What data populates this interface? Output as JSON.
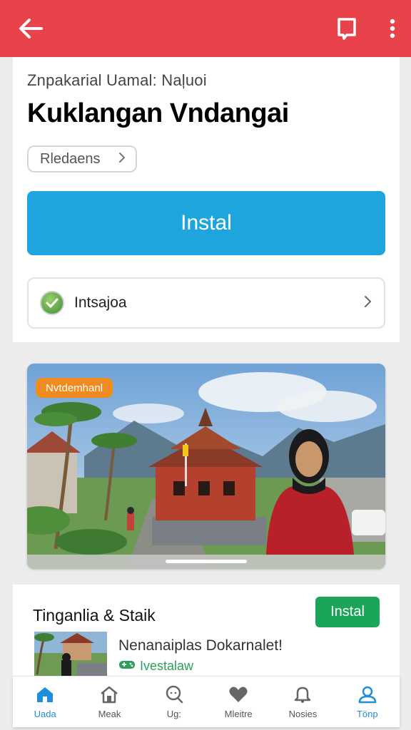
{
  "colors": {
    "appbar": "#e8424a",
    "install_primary": "#1fa5de",
    "install_secondary": "#1aa55b",
    "badge": "#f28b1f",
    "nav_active": "#1e8fd8"
  },
  "appbar": {
    "back_icon": "arrow-left-icon",
    "right_icons": [
      "bookmark-icon",
      "more-vert-icon"
    ]
  },
  "app": {
    "subtitle": "Znpakarial Uamal: Naļuoi",
    "title": "Kuklangan Vndangai",
    "chip_label": "Rledaens",
    "install_label": "Instal",
    "developer_name": "Intsajoa"
  },
  "media": {
    "badge": "Nvtdemhanl"
  },
  "section": {
    "title": "Tinganlia & Staik",
    "install_label": "Instal",
    "item_name": "Nenanaiplas Dokarnalet!",
    "item_tag": "Ivestalaw"
  },
  "bottom_nav": {
    "items": [
      {
        "label": "Uada",
        "icon": "home-icon",
        "active": true
      },
      {
        "label": "Meak",
        "icon": "house-icon",
        "active": false
      },
      {
        "label": "Ug:",
        "icon": "search-chat-icon",
        "active": false
      },
      {
        "label": "Mleitre",
        "icon": "heart-icon",
        "active": false
      },
      {
        "label": "Nosies",
        "icon": "bell-icon",
        "active": false
      },
      {
        "label": "Tönp",
        "icon": "profile-icon",
        "active": true
      }
    ]
  }
}
